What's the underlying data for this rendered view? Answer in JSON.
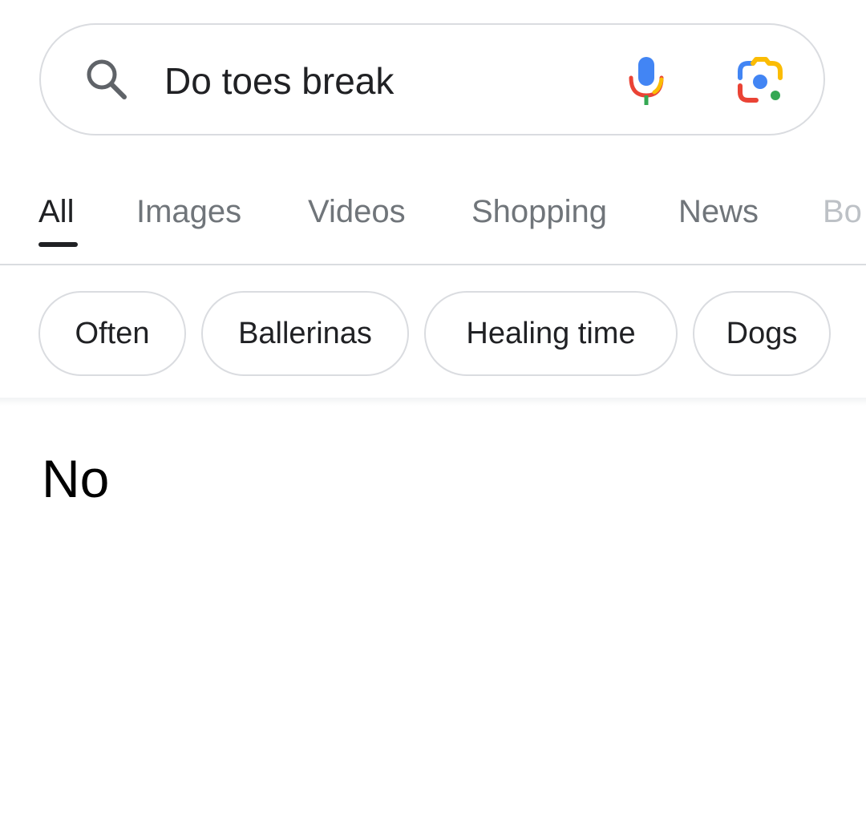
{
  "search": {
    "query": "Do toes break"
  },
  "icons": {
    "search": "search-icon",
    "voice": "microphone-icon",
    "lens": "camera-lens-icon"
  },
  "colors": {
    "google_blue": "#4285f4",
    "google_red": "#ea4335",
    "google_yellow": "#fbbc04",
    "google_green": "#34a853",
    "active_text": "#202124",
    "inactive_text": "#70757a"
  },
  "tabs": [
    {
      "label": "All",
      "active": true
    },
    {
      "label": "Images"
    },
    {
      "label": "Videos"
    },
    {
      "label": "Shopping"
    },
    {
      "label": "News"
    },
    {
      "label": "Bo"
    }
  ],
  "chips": [
    {
      "label": "Often"
    },
    {
      "label": "Ballerinas"
    },
    {
      "label": "Healing time"
    },
    {
      "label": "Dogs"
    }
  ],
  "result": {
    "answer": "No"
  }
}
